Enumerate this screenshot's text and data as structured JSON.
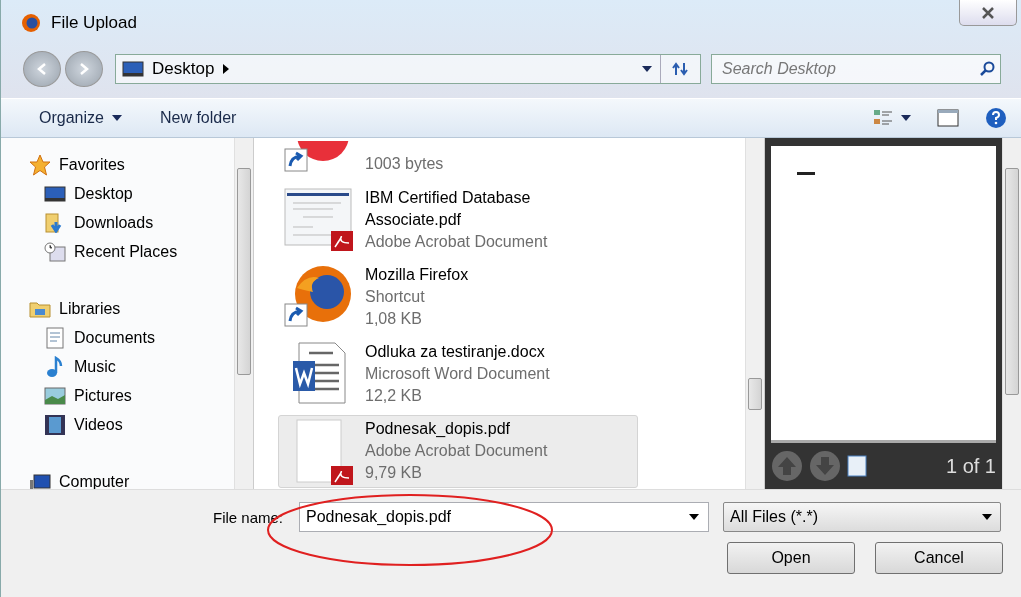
{
  "window": {
    "title": "File Upload"
  },
  "address": {
    "path": "Desktop"
  },
  "search": {
    "placeholder": "Search Desktop"
  },
  "toolbar": {
    "organize": "Organize",
    "new_folder": "New folder"
  },
  "sidebar": [
    {
      "label": "Favorites",
      "kind": "star",
      "children": [
        {
          "label": "Desktop",
          "kind": "desktop"
        },
        {
          "label": "Downloads",
          "kind": "downloads"
        },
        {
          "label": "Recent Places",
          "kind": "recent"
        }
      ]
    },
    {
      "label": "Libraries",
      "kind": "libraries",
      "children": [
        {
          "label": "Documents",
          "kind": "documents"
        },
        {
          "label": "Music",
          "kind": "music"
        },
        {
          "label": "Pictures",
          "kind": "pictures"
        },
        {
          "label": "Videos",
          "kind": "videos"
        }
      ]
    },
    {
      "label": "Computer",
      "kind": "computer"
    }
  ],
  "files": [
    {
      "kind": "red-shortcut",
      "lines": [
        "1003 bytes"
      ],
      "selected": false
    },
    {
      "kind": "pdf-thumb",
      "lines": [
        "IBM Certified Database",
        "Associate.pdf",
        "Adobe Acrobat Document"
      ],
      "selected": false
    },
    {
      "kind": "firefox-shortcut",
      "lines": [
        "Mozilla Firefox",
        "Shortcut",
        "1,08 KB"
      ],
      "selected": false
    },
    {
      "kind": "word",
      "lines": [
        "Odluka za testiranje.docx",
        "Microsoft Word Document",
        "12,2 KB"
      ],
      "selected": false
    },
    {
      "kind": "pdf-blank",
      "lines": [
        "Podnesak_dopis.pdf",
        "Adobe Acrobat Document",
        "9,79 KB"
      ],
      "selected": true
    }
  ],
  "preview": {
    "page_label": "1 of 1"
  },
  "bottom": {
    "file_name_label": "File name:",
    "file_name_value": "Podnesak_dopis.pdf",
    "filter": "All Files (*.*)",
    "buttons": [
      "Open",
      "Cancel"
    ]
  }
}
